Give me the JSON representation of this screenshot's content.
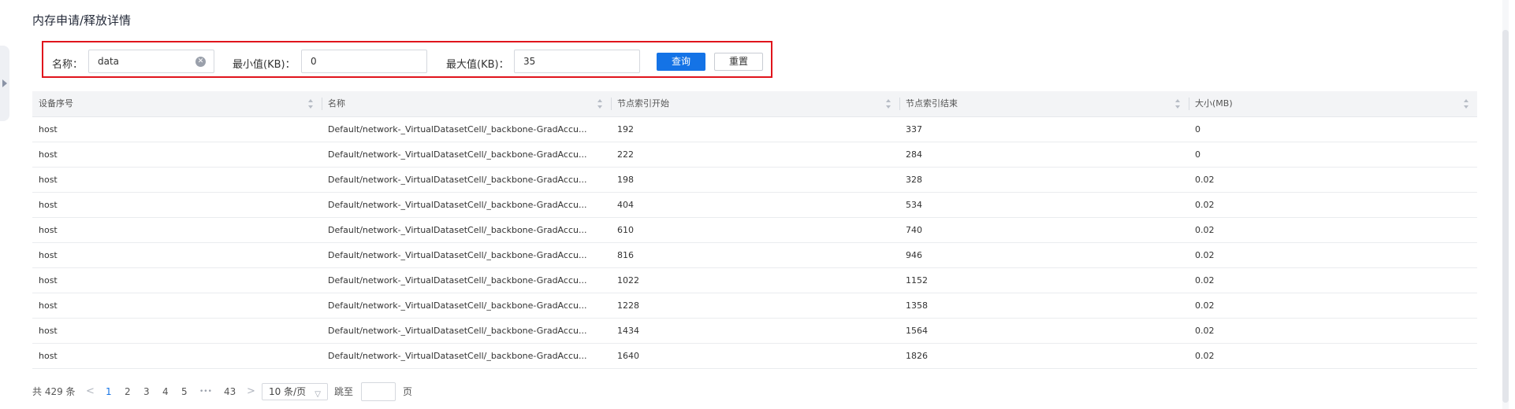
{
  "title": "内存申请/释放详情",
  "filter": {
    "name_label": "名称：",
    "name_value": "data",
    "min_label": "最小值(KB)：",
    "min_value": "0",
    "max_label": "最大值(KB)：",
    "max_value": "35",
    "query_label": "查询",
    "reset_label": "重置"
  },
  "table": {
    "columns": [
      "设备序号",
      "名称",
      "节点索引开始",
      "节点索引结束",
      "大小(MB)"
    ],
    "rows": [
      [
        "host",
        "Default/network-_VirtualDatasetCell/_backbone-GradAccu...",
        "192",
        "337",
        "0"
      ],
      [
        "host",
        "Default/network-_VirtualDatasetCell/_backbone-GradAccu...",
        "222",
        "284",
        "0"
      ],
      [
        "host",
        "Default/network-_VirtualDatasetCell/_backbone-GradAccu...",
        "198",
        "328",
        "0.02"
      ],
      [
        "host",
        "Default/network-_VirtualDatasetCell/_backbone-GradAccu...",
        "404",
        "534",
        "0.02"
      ],
      [
        "host",
        "Default/network-_VirtualDatasetCell/_backbone-GradAccu...",
        "610",
        "740",
        "0.02"
      ],
      [
        "host",
        "Default/network-_VirtualDatasetCell/_backbone-GradAccu...",
        "816",
        "946",
        "0.02"
      ],
      [
        "host",
        "Default/network-_VirtualDatasetCell/_backbone-GradAccu...",
        "1022",
        "1152",
        "0.02"
      ],
      [
        "host",
        "Default/network-_VirtualDatasetCell/_backbone-GradAccu...",
        "1228",
        "1358",
        "0.02"
      ],
      [
        "host",
        "Default/network-_VirtualDatasetCell/_backbone-GradAccu...",
        "1434",
        "1564",
        "0.02"
      ],
      [
        "host",
        "Default/network-_VirtualDatasetCell/_backbone-GradAccu...",
        "1640",
        "1826",
        "0.02"
      ]
    ]
  },
  "pagination": {
    "total_text": "共 429 条",
    "pages": [
      "1",
      "2",
      "3",
      "4",
      "5"
    ],
    "ellipsis": "•••",
    "last_page": "43",
    "current_page": "1",
    "page_size": "10 条/页",
    "jump_label": "跳至",
    "page_suffix": "页"
  },
  "colors": {
    "accent": "#1473e6",
    "highlight_border": "#e0141c"
  }
}
